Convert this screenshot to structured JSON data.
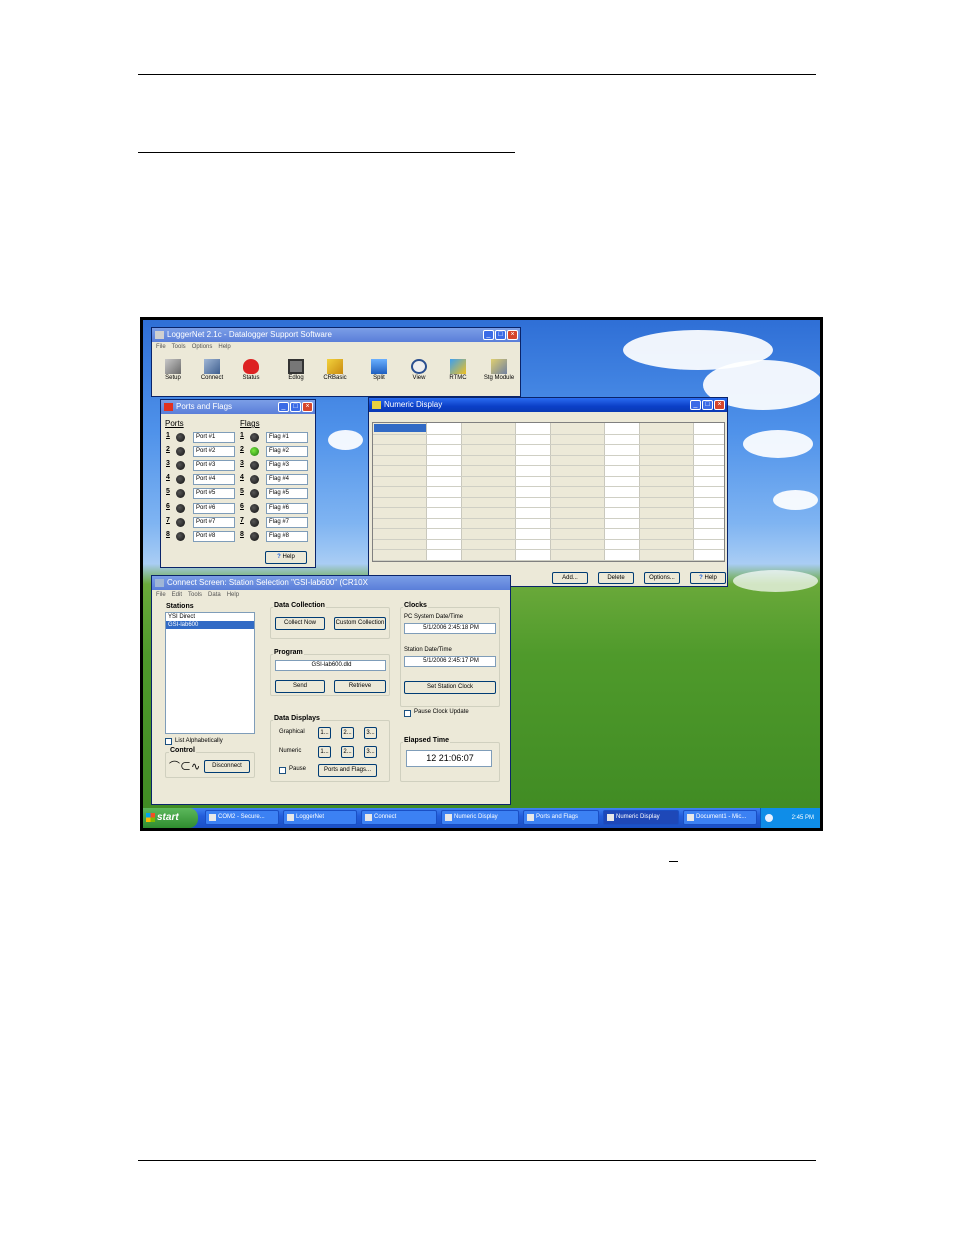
{
  "screen": {
    "loggernet": {
      "title": "LoggerNet 2.1c - Datalogger Support Software",
      "menu": [
        "File",
        "Tools",
        "Options",
        "Help"
      ],
      "tools": [
        {
          "label": "Setup",
          "icon": "setup-icon"
        },
        {
          "label": "Connect",
          "icon": "connect-icon"
        },
        {
          "label": "Status",
          "icon": "status-icon"
        },
        {
          "label": "Edlog",
          "icon": "edlog-icon"
        },
        {
          "label": "CRBasic",
          "icon": "crbasic-icon"
        },
        {
          "label": "Split",
          "icon": "split-icon"
        },
        {
          "label": "View",
          "icon": "view-icon"
        },
        {
          "label": "RTMC",
          "icon": "rtmc-icon"
        },
        {
          "label": "Stg Module",
          "icon": "storage-module-icon"
        }
      ]
    },
    "ports_flags": {
      "title": "Ports and Flags",
      "ports_header": "Ports",
      "flags_header": "Flags",
      "ports": [
        {
          "num": "1",
          "label": "Port #1"
        },
        {
          "num": "2",
          "label": "Port #2"
        },
        {
          "num": "3",
          "label": "Port #3"
        },
        {
          "num": "4",
          "label": "Port #4"
        },
        {
          "num": "5",
          "label": "Port #5"
        },
        {
          "num": "6",
          "label": "Port #6"
        },
        {
          "num": "7",
          "label": "Port #7"
        },
        {
          "num": "8",
          "label": "Port #8"
        }
      ],
      "flags": [
        {
          "num": "1",
          "label": "Flag #1",
          "on": false
        },
        {
          "num": "2",
          "label": "Flag #2",
          "on": true
        },
        {
          "num": "3",
          "label": "Flag #3",
          "on": false
        },
        {
          "num": "4",
          "label": "Flag #4",
          "on": false
        },
        {
          "num": "5",
          "label": "Flag #5",
          "on": false
        },
        {
          "num": "6",
          "label": "Flag #6",
          "on": false
        },
        {
          "num": "7",
          "label": "Flag #7",
          "on": false
        },
        {
          "num": "8",
          "label": "Flag #8",
          "on": false
        }
      ],
      "help": "Help"
    },
    "numeric": {
      "title": "Numeric Display",
      "buttons": [
        "Add...",
        "Delete",
        "Options...",
        "Help"
      ]
    },
    "connect": {
      "title": "Connect Screen: Station Selection \"GSI-lab600\" (CR10X",
      "menu": [
        "File",
        "Edit",
        "Tools",
        "Data",
        "Help"
      ],
      "stations_label": "Stations",
      "stations": [
        "YSI Direct",
        "GSI-lab600"
      ],
      "list_alpha": "List Alphabetically",
      "control_label": "Control",
      "disconnect": "Disconnect",
      "data_collection_label": "Data Collection",
      "collect_now": "Collect Now",
      "custom_collection": "Custom Collection",
      "program_label": "Program",
      "program_file": "GSI-lab600.dld",
      "send": "Send",
      "retrieve": "Retrieve",
      "data_displays_label": "Data Displays",
      "graphical": "Graphical",
      "numeric": "Numeric",
      "disp_buttons": [
        "1...",
        "2...",
        "3..."
      ],
      "pause": "Pause",
      "ports_flags_btn": "Ports and Flags...",
      "clocks_label": "Clocks",
      "pc_time_label": "PC System Date/Time",
      "pc_time": "5/1/2006 2:45:18 PM",
      "station_time_label": "Station Date/Time",
      "station_time": "5/1/2006 2:45:17 PM",
      "set_clock": "Set Station Clock",
      "pause_clock": "Pause Clock Update",
      "elapsed_label": "Elapsed Time",
      "elapsed": "12 21:06:07"
    },
    "taskbar": {
      "start": "start",
      "tasks": [
        "COM2 - Secure...",
        "LoggerNet",
        "Connect",
        "Numeric Display",
        "Ports and Flags",
        "Numeric Display",
        "Document1 - Mic..."
      ],
      "clock": "2:45 PM"
    }
  }
}
